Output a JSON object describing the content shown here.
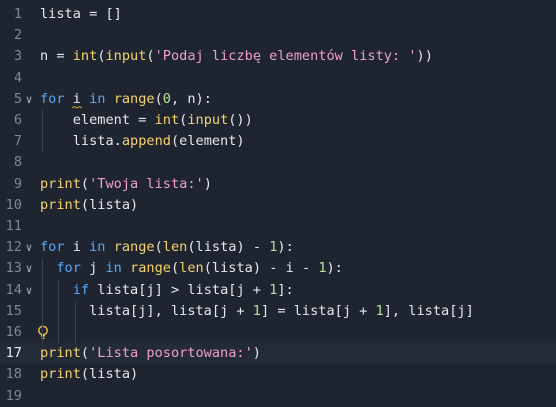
{
  "editor": {
    "current_line": 17,
    "lines": [
      {
        "num": "1",
        "tokens": [
          {
            "t": "lista = []",
            "c": "id"
          }
        ]
      },
      {
        "num": "2",
        "tokens": []
      },
      {
        "num": "3",
        "tokens": [
          {
            "t": "n = ",
            "c": "id"
          },
          {
            "t": "int",
            "c": "fn"
          },
          {
            "t": "(",
            "c": "op"
          },
          {
            "t": "input",
            "c": "fn"
          },
          {
            "t": "(",
            "c": "op"
          },
          {
            "t": "'Podaj liczbę elementów listy: '",
            "c": "st"
          },
          {
            "t": "))",
            "c": "op"
          }
        ]
      },
      {
        "num": "4",
        "tokens": []
      },
      {
        "num": "5",
        "fold": "∨",
        "tokens": [
          {
            "t": "for",
            "c": "kw"
          },
          {
            "t": " i ",
            "c": "id"
          },
          {
            "t": "in",
            "c": "kw"
          },
          {
            "t": " ",
            "c": "id"
          },
          {
            "t": "range",
            "c": "fn"
          },
          {
            "t": "(",
            "c": "op"
          },
          {
            "t": "0",
            "c": "nm"
          },
          {
            "t": ", n):",
            "c": "id"
          }
        ]
      },
      {
        "num": "6",
        "tokens": [
          {
            "t": "    element = ",
            "c": "id"
          },
          {
            "t": "int",
            "c": "fn"
          },
          {
            "t": "(",
            "c": "op"
          },
          {
            "t": "input",
            "c": "fn"
          },
          {
            "t": "())",
            "c": "op"
          }
        ]
      },
      {
        "num": "7",
        "tokens": [
          {
            "t": "    lista.",
            "c": "id"
          },
          {
            "t": "append",
            "c": "fn"
          },
          {
            "t": "(element)",
            "c": "id"
          }
        ]
      },
      {
        "num": "8",
        "tokens": []
      },
      {
        "num": "9",
        "tokens": [
          {
            "t": "print",
            "c": "fn"
          },
          {
            "t": "(",
            "c": "op"
          },
          {
            "t": "'Twoja lista:'",
            "c": "st"
          },
          {
            "t": ")",
            "c": "op"
          }
        ]
      },
      {
        "num": "10",
        "tokens": [
          {
            "t": "print",
            "c": "fn"
          },
          {
            "t": "(lista)",
            "c": "id"
          }
        ]
      },
      {
        "num": "11",
        "tokens": []
      },
      {
        "num": "12",
        "fold": "∨",
        "tokens": [
          {
            "t": "for",
            "c": "kw"
          },
          {
            "t": " i ",
            "c": "id"
          },
          {
            "t": "in",
            "c": "kw"
          },
          {
            "t": " ",
            "c": "id"
          },
          {
            "t": "range",
            "c": "fn"
          },
          {
            "t": "(",
            "c": "op"
          },
          {
            "t": "len",
            "c": "fn"
          },
          {
            "t": "(lista) - ",
            "c": "id"
          },
          {
            "t": "1",
            "c": "nm"
          },
          {
            "t": "):",
            "c": "id"
          }
        ]
      },
      {
        "num": "13",
        "fold": "∨",
        "tokens": [
          {
            "t": "  ",
            "c": "id"
          },
          {
            "t": "for",
            "c": "kw"
          },
          {
            "t": " j ",
            "c": "id"
          },
          {
            "t": "in",
            "c": "kw"
          },
          {
            "t": " ",
            "c": "id"
          },
          {
            "t": "range",
            "c": "fn"
          },
          {
            "t": "(",
            "c": "op"
          },
          {
            "t": "len",
            "c": "fn"
          },
          {
            "t": "(lista) - i - ",
            "c": "id"
          },
          {
            "t": "1",
            "c": "nm"
          },
          {
            "t": "):",
            "c": "id"
          }
        ]
      },
      {
        "num": "14",
        "fold": "∨",
        "tokens": [
          {
            "t": "    ",
            "c": "id"
          },
          {
            "t": "if",
            "c": "kw"
          },
          {
            "t": " lista[j] > lista[j + ",
            "c": "id"
          },
          {
            "t": "1",
            "c": "nm"
          },
          {
            "t": "]:",
            "c": "id"
          }
        ]
      },
      {
        "num": "15",
        "tokens": [
          {
            "t": "      lista[j], lista[j + ",
            "c": "id"
          },
          {
            "t": "1",
            "c": "nm"
          },
          {
            "t": "] = lista[j + ",
            "c": "id"
          },
          {
            "t": "1",
            "c": "nm"
          },
          {
            "t": "], lista[j]",
            "c": "id"
          }
        ]
      },
      {
        "num": "16",
        "bulb": true,
        "tokens": []
      },
      {
        "num": "17",
        "tokens": [
          {
            "t": "print",
            "c": "fn"
          },
          {
            "t": "(",
            "c": "op"
          },
          {
            "t": "'Lista posortowana:'",
            "c": "st"
          },
          {
            "t": ")",
            "c": "op"
          }
        ]
      },
      {
        "num": "18",
        "tokens": [
          {
            "t": "print",
            "c": "fn"
          },
          {
            "t": "(lista)",
            "c": "id"
          }
        ]
      },
      {
        "num": "19",
        "tokens": []
      }
    ]
  },
  "colors": {
    "background": "#1e2430",
    "current_line": "#242b38",
    "keyword": "#56a8f5",
    "function": "#f5d36b",
    "string": "#f0a0c8",
    "number": "#b8e0a0",
    "text": "#e6e8ec",
    "gutter": "#7e8796",
    "bulb": "#f5c542",
    "squiggle": "#d6a436"
  },
  "icons": {
    "fold_marker": "chevron-down-icon",
    "lightbulb": "lightbulb-icon",
    "warning_underline": "squiggle-underline"
  }
}
